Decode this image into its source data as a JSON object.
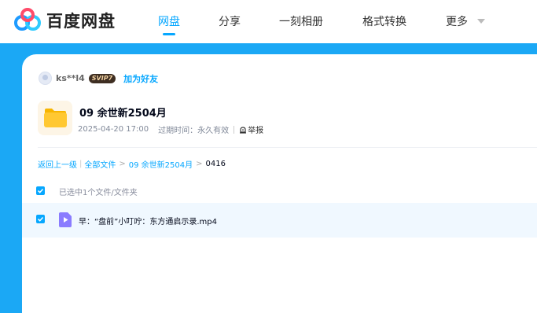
{
  "brand": {
    "name": "百度网盘",
    "logo_icon": "baidu-netdisk-logo-icon"
  },
  "nav": {
    "items": [
      {
        "label": "网盘",
        "active": true
      },
      {
        "label": "分享",
        "active": false
      },
      {
        "label": "一刻相册",
        "active": false
      },
      {
        "label": "格式转换",
        "active": false
      },
      {
        "label": "更多",
        "active": false
      }
    ],
    "more_icon": "caret-down-icon"
  },
  "colors": {
    "accent": "#06a7ff",
    "background_blue": "#1ba8f5",
    "folder_yellow": "#ffc832"
  },
  "share": {
    "user": {
      "name": "ks**l4",
      "badge": "SVIP7",
      "add_friend": "加为好友"
    },
    "folder": {
      "title": "09 余世新2504月",
      "date": "2025-04-20 17:00",
      "expiry_label": "过期时间：永久有效",
      "report": "举报",
      "icon": "folder-icon"
    },
    "breadcrumb": {
      "back": "返回上一级",
      "all_files": "全部文件",
      "parent": "09 余世新2504月",
      "current": "0416"
    },
    "selection": {
      "text": "已选中1个文件/文件夹",
      "checked": true
    },
    "files": [
      {
        "name": "早：“盘前”小叮咛：东方通启示录.mp4",
        "checked": true,
        "icon": "video-file-icon"
      }
    ]
  }
}
